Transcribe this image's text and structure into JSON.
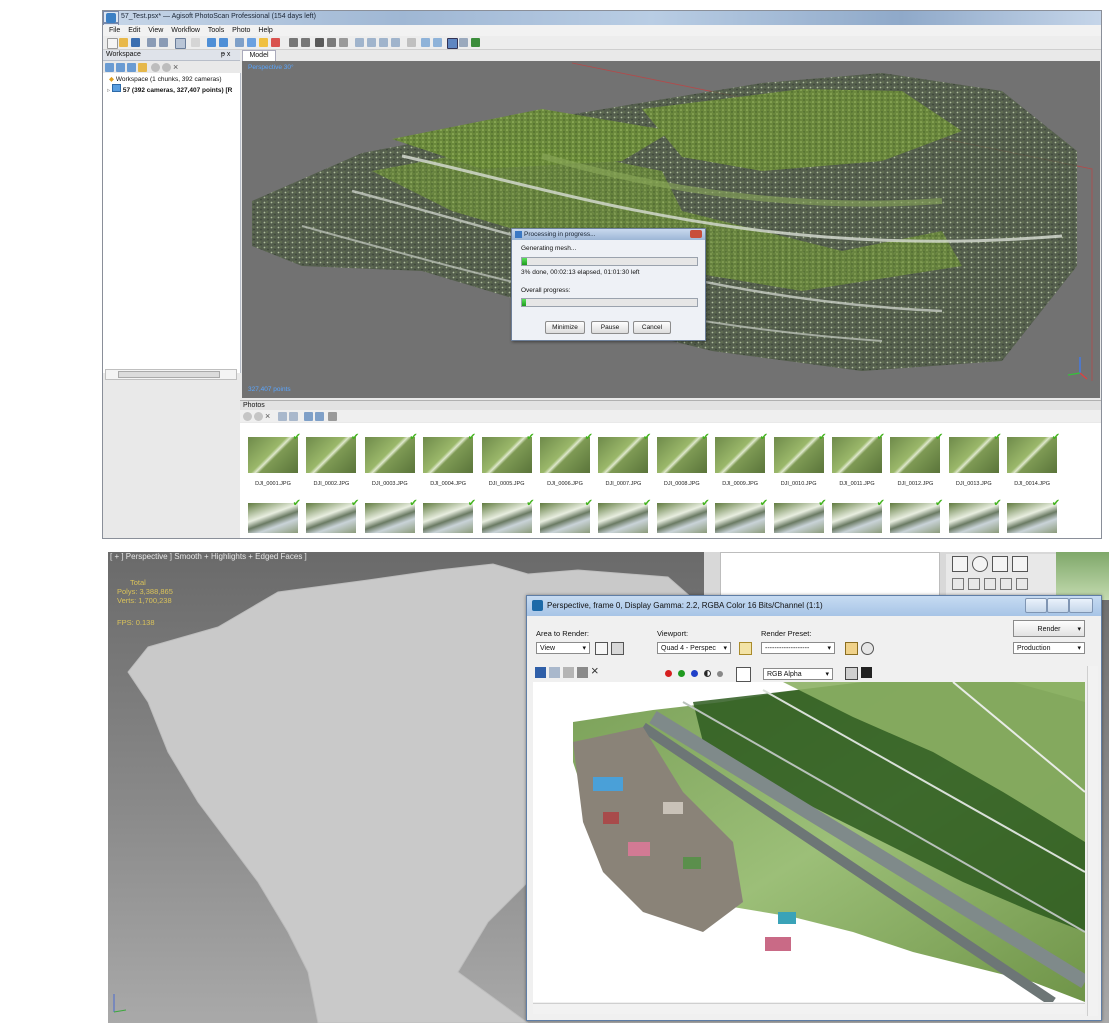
{
  "photoscan": {
    "title": "57_Test.psx* — Agisoft PhotoScan Professional (154 days left)",
    "menu": [
      "File",
      "Edit",
      "View",
      "Workflow",
      "Tools",
      "Photo",
      "Help"
    ],
    "workspace": {
      "header": "Workspace",
      "pin": "ᵽ x",
      "root": "Workspace (1 chunks, 392 cameras)",
      "chunk": "57 (392 cameras, 327,407 points) [R"
    },
    "model_tab": "Model",
    "viewport": {
      "projection_label": "Perspective 30°",
      "points_label": "327,407 points"
    },
    "progress_dialog": {
      "title": "Processing in progress...",
      "task": "Generating mesh...",
      "status": "3% done, 00:02:13 elapsed, 01:01:30 left",
      "task_progress": 0.03,
      "overall_label": "Overall progress:",
      "overall_progress": 0.02,
      "buttons": {
        "minimize": "Minimize",
        "pause": "Pause",
        "cancel": "Cancel"
      }
    },
    "photos": {
      "header": "Photos",
      "names": [
        "DJI_0001.JPG",
        "DJI_0002.JPG",
        "DJI_0003.JPG",
        "DJI_0004.JPG",
        "DJI_0005.JPG",
        "DJI_0006.JPG",
        "DJI_0007.JPG",
        "DJI_0008.JPG",
        "DJI_0009.JPG",
        "DJI_0010.JPG",
        "DJI_0011.JPG",
        "DJI_0012.JPG",
        "DJI_0013.JPG",
        "DJI_0014.JPG"
      ]
    }
  },
  "max": {
    "viewport_label": "[ + ] Perspective ] Smooth + Highlights + Edged Faces ]",
    "stats": {
      "total": "Total",
      "polys": "Polys: 3,388,865",
      "verts": "Verts: 1,700,238",
      "fps": "FPS:   0.138"
    },
    "render_window": {
      "title": "Perspective, frame 0, Display Gamma: 2.2, RGBA Color 16 Bits/Channel (1:1)",
      "area_label": "Area to Render:",
      "area_value": "View",
      "viewport_label": "Viewport:",
      "viewport_value": "Quad 4 - Perspec",
      "preset_label": "Render Preset:",
      "preset_value": "-------------------",
      "render_button": "Render",
      "mode_value": "Production",
      "channel_value": "RGB Alpha"
    }
  },
  "colors": {
    "accent_blue": "#5aa6ff",
    "progress_green": "#2eb82e",
    "stat_yellow": "#d9c25a"
  }
}
